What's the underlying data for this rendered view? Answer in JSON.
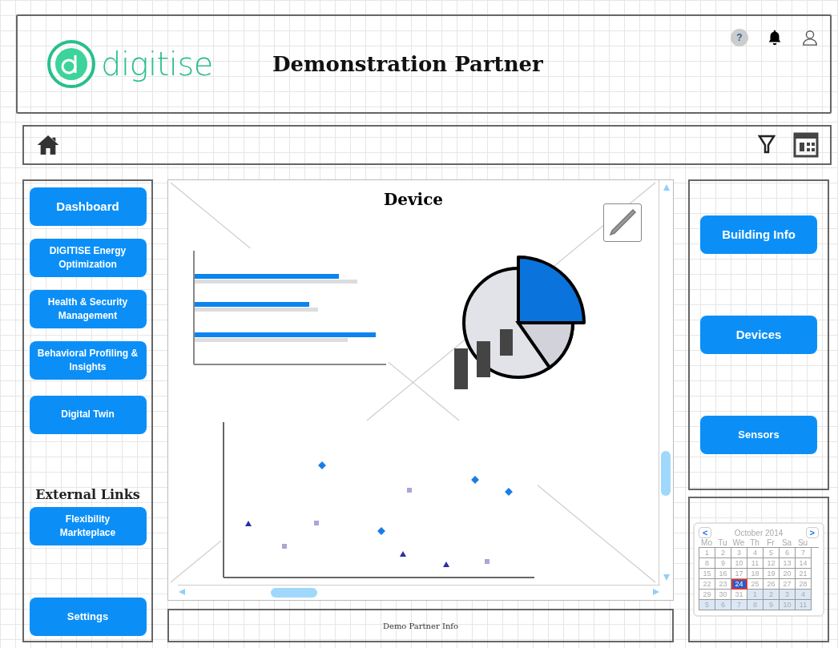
{
  "header": {
    "logo_text": "digitise",
    "title": "Demonstration Partner",
    "help_label": "?"
  },
  "sidebar": {
    "items": [
      {
        "label": "Dashboard"
      },
      {
        "label": "DIGITISE Energy Optimization"
      },
      {
        "label": "Health & Security Management"
      },
      {
        "label": "Behavioral Profiling & Insights"
      },
      {
        "label": "Digital Twin"
      }
    ],
    "external_heading": "External Links",
    "external_items": [
      {
        "label": "Flexibility Markteplace"
      }
    ],
    "settings": "Settings"
  },
  "content": {
    "title": "Device",
    "footer": "Demo Partner Info"
  },
  "right_panel": {
    "buttons": [
      "Building Info",
      "Devices",
      "Sensors"
    ]
  },
  "calendar": {
    "month": "October 2014",
    "prev": "<",
    "next": ">",
    "weekdays": [
      "Mo",
      "Tu",
      "We",
      "Th",
      "Fr",
      "Sa",
      "Su"
    ],
    "weeks": [
      [
        {
          "day": "1",
          "other_month": false,
          "selected": false
        },
        {
          "day": "2",
          "other_month": false,
          "selected": false
        },
        {
          "day": "3",
          "other_month": false,
          "selected": false
        },
        {
          "day": "4",
          "other_month": false,
          "selected": false
        },
        {
          "day": "5",
          "other_month": false,
          "selected": false
        },
        {
          "day": "6",
          "other_month": false,
          "selected": false
        },
        {
          "day": "7",
          "other_month": false,
          "selected": false
        }
      ],
      [
        {
          "day": "8",
          "other_month": false,
          "selected": false
        },
        {
          "day": "9",
          "other_month": false,
          "selected": false
        },
        {
          "day": "10",
          "other_month": false,
          "selected": false
        },
        {
          "day": "11",
          "other_month": false,
          "selected": false
        },
        {
          "day": "12",
          "other_month": false,
          "selected": false
        },
        {
          "day": "13",
          "other_month": false,
          "selected": false
        },
        {
          "day": "14",
          "other_month": false,
          "selected": false
        }
      ],
      [
        {
          "day": "15",
          "other_month": false,
          "selected": false
        },
        {
          "day": "16",
          "other_month": false,
          "selected": false
        },
        {
          "day": "17",
          "other_month": false,
          "selected": false
        },
        {
          "day": "18",
          "other_month": false,
          "selected": false
        },
        {
          "day": "19",
          "other_month": false,
          "selected": false
        },
        {
          "day": "20",
          "other_month": false,
          "selected": false
        },
        {
          "day": "21",
          "other_month": false,
          "selected": false
        }
      ],
      [
        {
          "day": "22",
          "other_month": false,
          "selected": false
        },
        {
          "day": "23",
          "other_month": false,
          "selected": false
        },
        {
          "day": "24",
          "other_month": false,
          "selected": true
        },
        {
          "day": "25",
          "other_month": false,
          "selected": false
        },
        {
          "day": "26",
          "other_month": false,
          "selected": false
        },
        {
          "day": "27",
          "other_month": false,
          "selected": false
        },
        {
          "day": "28",
          "other_month": false,
          "selected": false
        }
      ],
      [
        {
          "day": "29",
          "other_month": false,
          "selected": false
        },
        {
          "day": "30",
          "other_month": false,
          "selected": false
        },
        {
          "day": "31",
          "other_month": false,
          "selected": false
        },
        {
          "day": "1",
          "other_month": true,
          "selected": false
        },
        {
          "day": "2",
          "other_month": true,
          "selected": false
        },
        {
          "day": "3",
          "other_month": true,
          "selected": false
        },
        {
          "day": "4",
          "other_month": true,
          "selected": false
        }
      ],
      [
        {
          "day": "5",
          "other_month": true,
          "selected": false
        },
        {
          "day": "6",
          "other_month": true,
          "selected": false
        },
        {
          "day": "7",
          "other_month": true,
          "selected": false
        },
        {
          "day": "8",
          "other_month": true,
          "selected": false
        },
        {
          "day": "9",
          "other_month": true,
          "selected": false
        },
        {
          "day": "10",
          "other_month": true,
          "selected": false
        },
        {
          "day": "11",
          "other_month": true,
          "selected": false
        }
      ]
    ]
  }
}
